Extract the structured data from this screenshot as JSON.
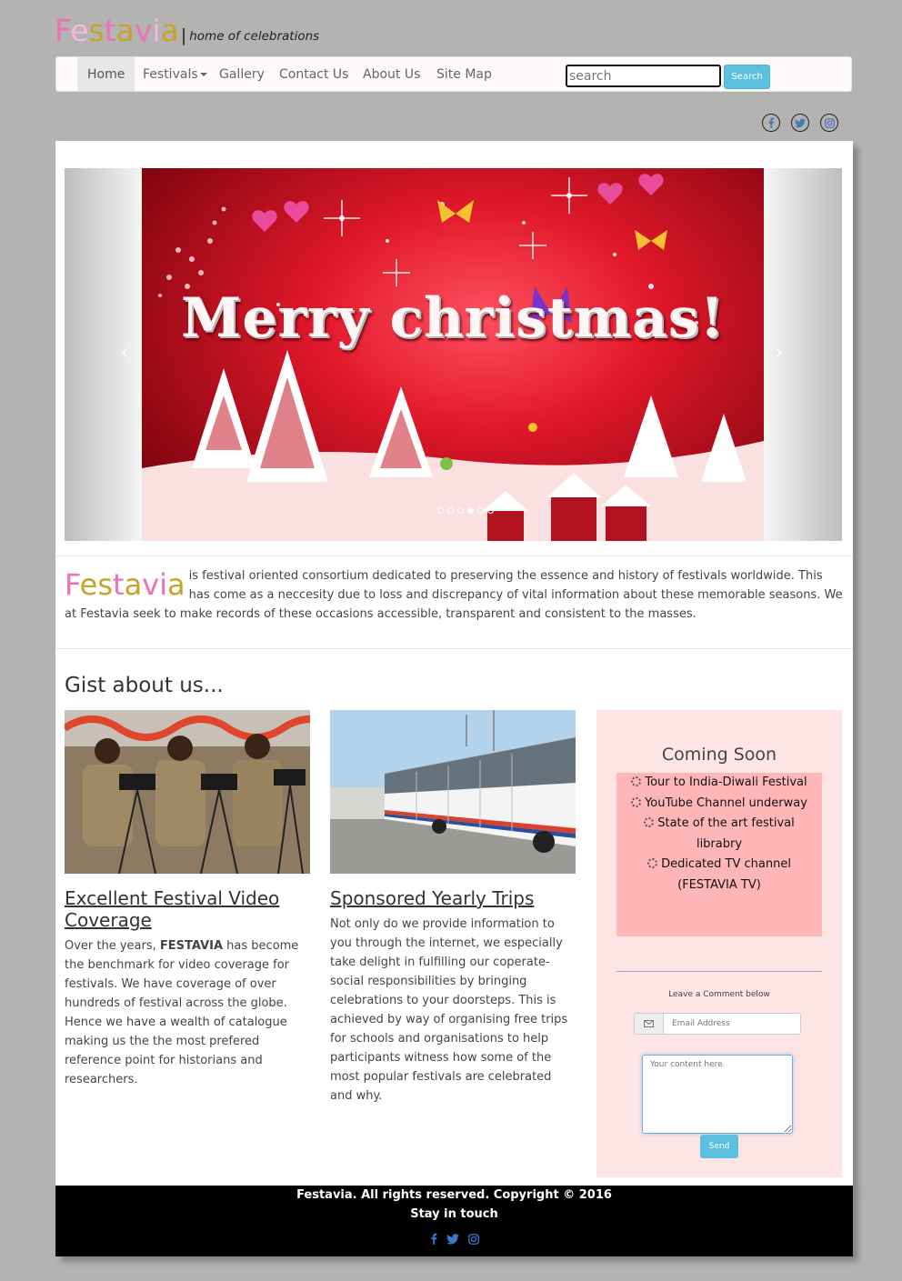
{
  "brand": {
    "logo_letters": [
      "F",
      "e",
      "s",
      "t",
      "a",
      "v",
      "i",
      "a"
    ],
    "separator": "|",
    "tagline": "home of celebrations"
  },
  "nav": {
    "items": [
      "Home",
      "Festivals",
      "Gallery",
      "Contact Us",
      "About Us",
      "Site Map"
    ],
    "active": "Home",
    "search_placeholder": "search",
    "search_button": "Search"
  },
  "social": [
    "facebook-icon",
    "twitter-icon",
    "instagram-icon"
  ],
  "carousel": {
    "slide_text": "Merry christmas!",
    "prev": "‹",
    "next": "›",
    "slide_count": 6,
    "active_index": 3
  },
  "intro": {
    "logo_letters": [
      "F",
      "e",
      "s",
      "t",
      "a",
      "v",
      "i",
      "a"
    ],
    "text": "is festival oriented consortium dedicated to preserving the essence and history of festivals worldwide. This has come as a neccesity due to loss and discrepancy of vital information about these memorable seasons. We at Festavia seek to make records of these occasions accessible, transparent and consistent to the masses."
  },
  "gist": {
    "title": "Gist about us...",
    "cards": [
      {
        "title": "Excellent Festival Video Coverage",
        "text_before": "Over the years, ",
        "text_bold": "FESTAVIA",
        "text_after": " has become the benchmark for video coverage for festivals. We have coverage of over hundreds of festival across the globe. Hence we have a wealth of catalogue making us the the most prefered reference point for historians and researchers."
      },
      {
        "title": "Sponsored Yearly Trips",
        "text": "Not only do we provide information to you through the internet, we especially take delight in fulfilling our coperate-social responsibilities by bringing celebrations to your doorsteps. This is achieved by way of organising free trips for schools and organisations to help participants witness how some of the most popular festivals are celebrated and why."
      }
    ]
  },
  "coming_soon": {
    "title": "Coming Soon",
    "items": [
      "Tour to India-Diwali Festival",
      "YouTube Channel underway",
      "State of the art festival librabry",
      "Dedicated TV channel (FESTAVIA TV)"
    ],
    "comment_label": "Leave a Comment below",
    "email_placeholder": "Email Address",
    "content_placeholder": "Your content here",
    "send_button": "Send"
  },
  "footer": {
    "copyright": "Festavia. All rights reserved. Copyright © 2016",
    "stay": "Stay in touch"
  },
  "colors": {
    "logo_pink": "#f06fb5",
    "logo_gold": "#c9a22b",
    "accent_blue": "#5bc0de",
    "coming_soon_bg": "#fde4e5",
    "coming_soon_list_bg": "#ffb6b6"
  }
}
